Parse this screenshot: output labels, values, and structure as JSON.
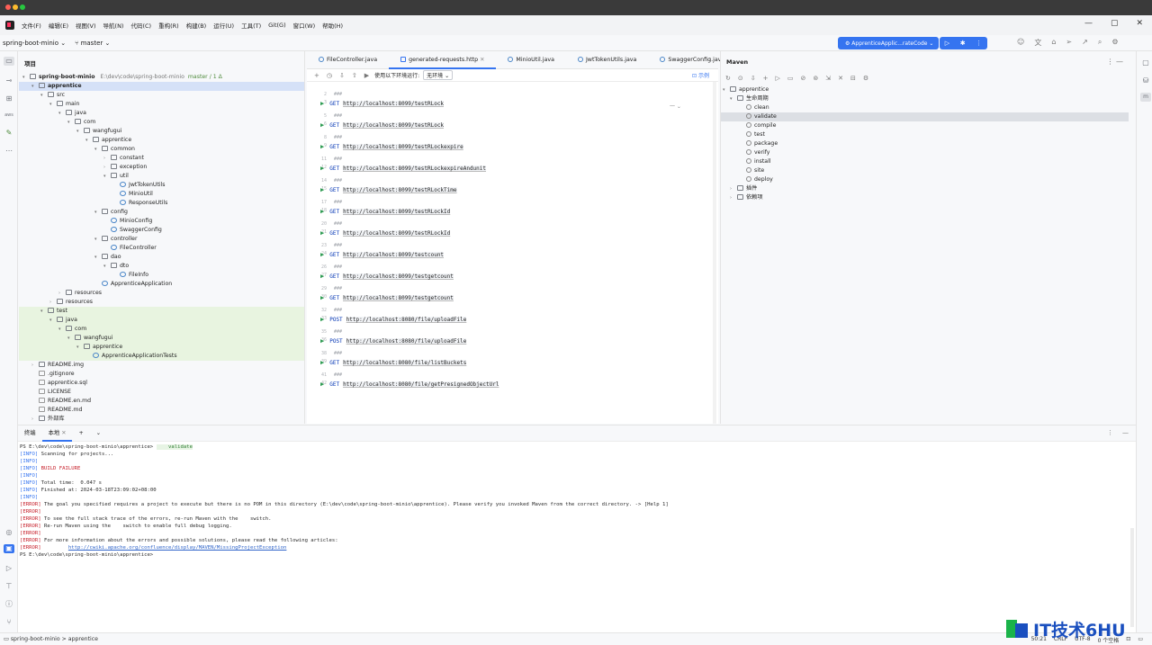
{
  "menubar": {
    "items": [
      "文件(F)",
      "编辑(E)",
      "视图(V)",
      "导航(N)",
      "代码(C)",
      "重构(R)",
      "构建(B)",
      "运行(U)",
      "工具(T)",
      "Git(G)",
      "窗口(W)",
      "帮助(H)"
    ]
  },
  "toolbar": {
    "project": "spring-boot-minio",
    "branch": "master",
    "run_config": "ApprenticeApplic...rateCode"
  },
  "project_panel": {
    "title": "项目",
    "root_name": "spring-boot-minio",
    "root_path": "E:\\dev\\code\\spring-boot-minio",
    "root_branch": "master / 1 Δ",
    "nodes": [
      "apprentice",
      "src",
      "main",
      "java",
      "com",
      "wangfugui",
      "apprentice",
      "common",
      "constant",
      "exception",
      "util",
      "JwtTokenUtils",
      "MinioUtil",
      "ResponseUtils",
      "config",
      "MinioConfig",
      "SwaggerConfig",
      "controller",
      "FileController",
      "dao",
      "dto",
      "FileInfo",
      "ApprenticeApplication",
      "resources",
      "resources",
      "test",
      "java",
      "com",
      "wangfugui",
      "apprentice",
      "ApprenticeApplicationTests",
      "README.img",
      ".gitignore",
      "apprentice.sql",
      "LICENSE",
      "README.en.md",
      "README.md",
      "外部库"
    ]
  },
  "editor": {
    "tabs": [
      "FileController.java",
      "generated-requests.http",
      "MinioUtil.java",
      "JwtTokenUtils.java",
      "SwaggerConfig.java"
    ],
    "env_label": "使用以下环境运行:",
    "env_value": "无环境",
    "env_right": "示例",
    "lang_hint": "一",
    "comment": "###",
    "requests": [
      {
        "method": "GET",
        "url": "http://localhost:8099/testRLock"
      },
      {
        "method": "GET",
        "url": "http://localhost:8099/testRLock"
      },
      {
        "method": "GET",
        "url": "http://localhost:8099/testRLockexpire"
      },
      {
        "method": "GET",
        "url": "http://localhost:8099/testRLockexpireAndunit"
      },
      {
        "method": "GET",
        "url": "http://localhost:8099/testRLockTime"
      },
      {
        "method": "GET",
        "url": "http://localhost:8099/testRLockId"
      },
      {
        "method": "GET",
        "url": "http://localhost:8099/testRLockId"
      },
      {
        "method": "GET",
        "url": "http://localhost:8099/testcount"
      },
      {
        "method": "GET",
        "url": "http://localhost:8099/testgetcount"
      },
      {
        "method": "GET",
        "url": "http://localhost:8099/testgetcount"
      },
      {
        "method": "POST",
        "url": "http://localhost:8080/file/uploadFile"
      },
      {
        "method": "POST",
        "url": "http://localhost:8080/file/uploadFile"
      },
      {
        "method": "GET",
        "url": "http://localhost:8080/file/listBuckets"
      },
      {
        "method": "GET",
        "url": "http://localhost:8080/file/getPresignedObjectUrl"
      }
    ]
  },
  "maven": {
    "title": "Maven",
    "project": "apprentice",
    "lifecycle": "生命周期",
    "goals": [
      "clean",
      "validate",
      "compile",
      "test",
      "package",
      "verify",
      "install",
      "site",
      "deploy"
    ],
    "plugins": "插件",
    "dependencies": "依赖项"
  },
  "terminal": {
    "tabs": [
      "终端",
      "本地"
    ],
    "prompt": "PS E:\\dev\\code\\spring-boot-minio\\apprentice>",
    "command": "validate",
    "lines": [
      {
        "tag": "[INFO]",
        "text": " Scanning for projects...",
        "kind": "info"
      },
      {
        "tag": "[INFO]",
        "text": "",
        "kind": "info"
      },
      {
        "tag": "[INFO]",
        "text": " BUILD FAILURE",
        "kind": "fail"
      },
      {
        "tag": "[INFO]",
        "text": "",
        "kind": "info"
      },
      {
        "tag": "[INFO]",
        "text": " Total time:  0.047 s",
        "kind": "info"
      },
      {
        "tag": "[INFO]",
        "text": " Finished at: 2024-03-18T23:09:02+08:00",
        "kind": "info"
      },
      {
        "tag": "[INFO]",
        "text": "",
        "kind": "info"
      },
      {
        "tag": "[ERROR]",
        "text": " The goal you specified requires a project to execute but there is no POM in this directory (E:\\dev\\code\\spring-boot-minio\\apprentice). Please verify you invoked Maven from the correct directory. -> [Help 1]",
        "kind": "err"
      },
      {
        "tag": "[ERROR]",
        "text": "",
        "kind": "err"
      },
      {
        "tag": "[ERROR]",
        "text": " To see the full stack trace of the errors, re-run Maven with the    switch.",
        "kind": "err"
      },
      {
        "tag": "[ERROR]",
        "text": " Re-run Maven using the    switch to enable full debug logging.",
        "kind": "err"
      },
      {
        "tag": "[ERROR]",
        "text": "",
        "kind": "err"
      },
      {
        "tag": "[ERROR]",
        "text": " For more information about the errors and possible solutions, please read the following articles:",
        "kind": "err"
      },
      {
        "tag": "[ERROR]",
        "text": "         ",
        "kind": "err",
        "link": "http://cwiki.apache.org/confluence/display/MAVEN/MissingProjectException"
      }
    ],
    "final_prompt": "PS E:\\dev\\code\\spring-boot-minio\\apprentice>"
  },
  "statusbar": {
    "breadcrumb_project": "spring-boot-minio",
    "breadcrumb_module": "apprentice",
    "position": "50:21",
    "line_sep": "CRLF",
    "encoding": "UTF-8",
    "indent": "0 个空格"
  },
  "watermark": "IT技术6HU"
}
